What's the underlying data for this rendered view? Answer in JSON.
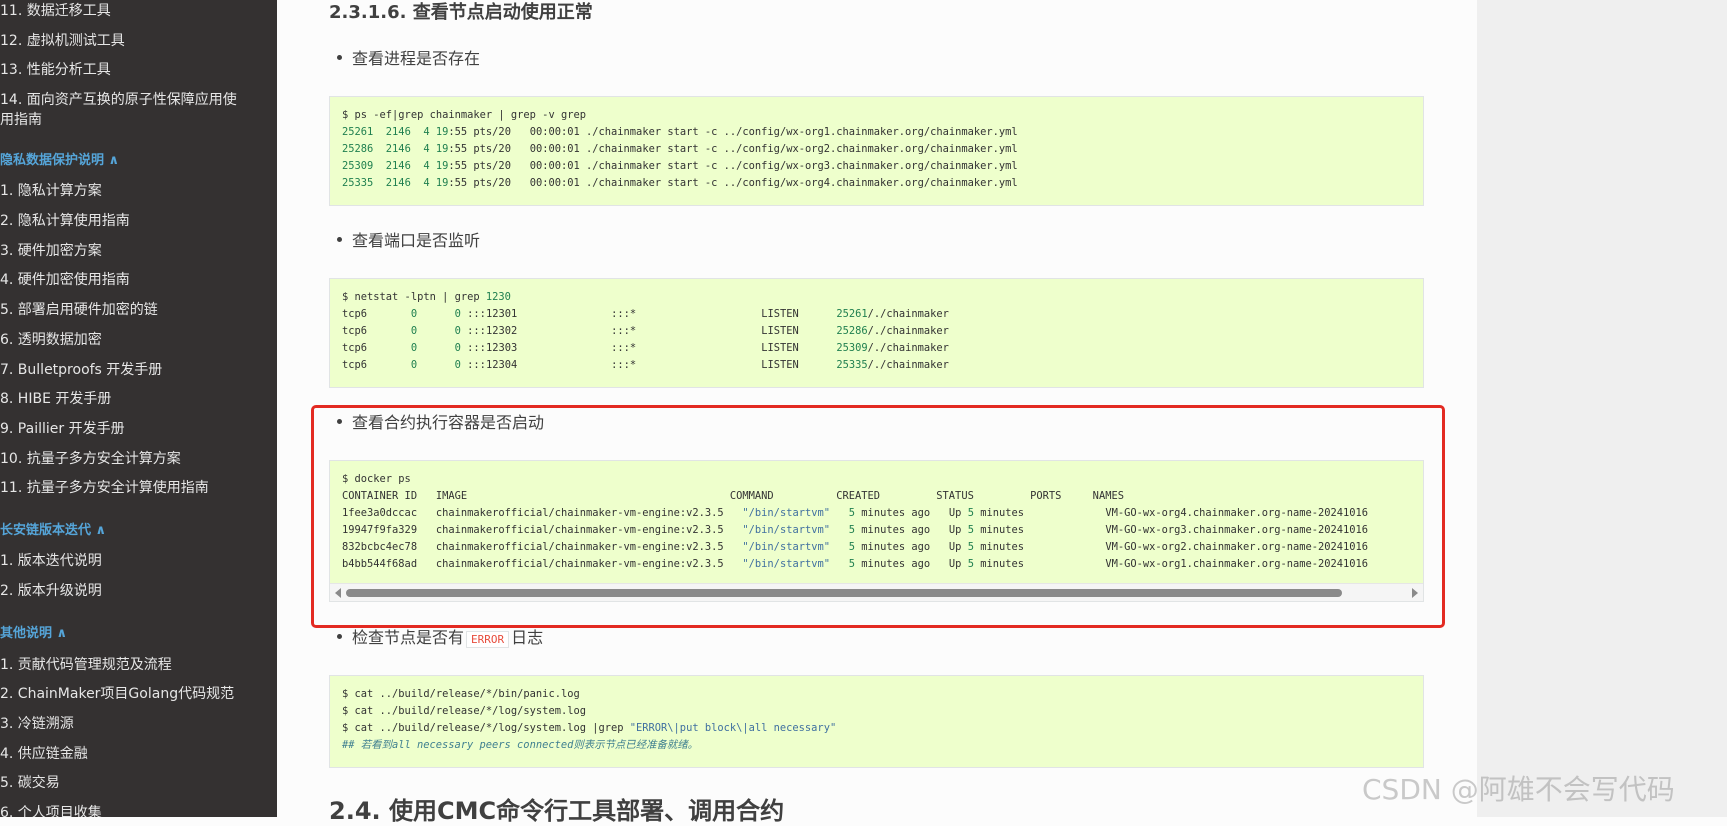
{
  "sidebar": {
    "group1": [
      "11. 数据迁移工具",
      "12. 虚拟机测试工具",
      "13. 性能分析工具",
      "14. 面向资产互换的原子性保障应用使用指南"
    ],
    "caption_privacy": "隐私数据保护说明 ∧",
    "group2": [
      "1. 隐私计算方案",
      "2. 隐私计算使用指南",
      "3. 硬件加密方案",
      "4. 硬件加密使用指南",
      "5. 部署启用硬件加密的链",
      "6. 透明数据加密",
      "7. Bulletproofs 开发手册",
      "8. HIBE 开发手册",
      "9. Paillier 开发手册",
      "10. 抗量子多方安全计算方案",
      "11. 抗量子多方安全计算使用指南"
    ],
    "caption_version": "长安链版本迭代 ∧",
    "group3": [
      "1. 版本迭代说明",
      "2. 版本升级说明"
    ],
    "caption_other": "其他说明 ∧",
    "group4": [
      "1. 贡献代码管理规范及流程",
      "2. ChainMaker项目Golang代码规范",
      "3. 冷链溯源",
      "4. 供应链金融",
      "5. 碳交易",
      "6. 个人项目收集"
    ]
  },
  "main": {
    "section_title": "2.3.1.6. 查看节点启动使用正常",
    "bullet_process": "查看进程是否存在",
    "bullet_port": "查看端口是否监听",
    "bullet_docker": "查看合约执行容器是否启动",
    "bullet_error_pre": "检查节点是否有",
    "bullet_error_code": "ERROR",
    "bullet_error_post": "日志",
    "next_title": "2.4. 使用CMC命令行工具部署、调用合约"
  },
  "code_ps": {
    "cmd": "$ ps -ef|grep chainmaker | grep -v grep",
    "rows": [
      {
        "pid": "25261",
        "ppid": "2146",
        "c": "4",
        "h": "19",
        "rest": ":55 pts/20   00:00:01 ./chainmaker start -c ../config/wx-org1.chainmaker.org/chainmaker.yml"
      },
      {
        "pid": "25286",
        "ppid": "2146",
        "c": "4",
        "h": "19",
        "rest": ":55 pts/20   00:00:01 ./chainmaker start -c ../config/wx-org2.chainmaker.org/chainmaker.yml"
      },
      {
        "pid": "25309",
        "ppid": "2146",
        "c": "4",
        "h": "19",
        "rest": ":55 pts/20   00:00:01 ./chainmaker start -c ../config/wx-org3.chainmaker.org/chainmaker.yml"
      },
      {
        "pid": "25335",
        "ppid": "2146",
        "c": "4",
        "h": "19",
        "rest": ":55 pts/20   00:00:01 ./chainmaker start -c ../config/wx-org4.chainmaker.org/chainmaker.yml"
      }
    ]
  },
  "code_netstat": {
    "cmd": "$ netstat -lptn | grep ",
    "cmd_num": "1230",
    "rows": [
      {
        "proto": "tcp6",
        "a": "0",
        "b": "0",
        "local": ":::12301",
        "foreign": ":::*",
        "state": "LISTEN",
        "pid": "25261",
        "prog": "/./chainmaker"
      },
      {
        "proto": "tcp6",
        "a": "0",
        "b": "0",
        "local": ":::12302",
        "foreign": ":::*",
        "state": "LISTEN",
        "pid": "25286",
        "prog": "/./chainmaker"
      },
      {
        "proto": "tcp6",
        "a": "0",
        "b": "0",
        "local": ":::12303",
        "foreign": ":::*",
        "state": "LISTEN",
        "pid": "25309",
        "prog": "/./chainmaker"
      },
      {
        "proto": "tcp6",
        "a": "0",
        "b": "0",
        "local": ":::12304",
        "foreign": ":::*",
        "state": "LISTEN",
        "pid": "25335",
        "prog": "/./chainmaker"
      }
    ]
  },
  "code_docker": {
    "cmd": "$ docker ps",
    "header": "CONTAINER ID   IMAGE                                          COMMAND          CREATED         STATUS         PORTS     NAMES",
    "rows": [
      {
        "id": "1fee3a0dccac",
        "image": "chainmakerofficial/chainmaker-vm-engine:v2.3.5",
        "command": "\"/bin/startvm\"",
        "created_n": "5",
        "created_t": " minutes ago",
        "status_p": "Up ",
        "status_n": "5",
        "status_t": " minutes",
        "name": "VM-GO-wx-org4.chainmaker.org-name-20241016"
      },
      {
        "id": "19947f9fa329",
        "image": "chainmakerofficial/chainmaker-vm-engine:v2.3.5",
        "command": "\"/bin/startvm\"",
        "created_n": "5",
        "created_t": " minutes ago",
        "status_p": "Up ",
        "status_n": "5",
        "status_t": " minutes",
        "name": "VM-GO-wx-org3.chainmaker.org-name-20241016"
      },
      {
        "id": "832bcbc4ec78",
        "image": "chainmakerofficial/chainmaker-vm-engine:v2.3.5",
        "command": "\"/bin/startvm\"",
        "created_n": "5",
        "created_t": " minutes ago",
        "status_p": "Up ",
        "status_n": "5",
        "status_t": " minutes",
        "name": "VM-GO-wx-org2.chainmaker.org-name-20241016"
      },
      {
        "id": "b4bb544f68ad",
        "image": "chainmakerofficial/chainmaker-vm-engine:v2.3.5",
        "command": "\"/bin/startvm\"",
        "created_n": "5",
        "created_t": " minutes ago",
        "status_p": "Up ",
        "status_n": "5",
        "status_t": " minutes",
        "name": "VM-GO-wx-org1.chainmaker.org-name-20241016"
      }
    ]
  },
  "code_log": {
    "line1": "$ cat ../build/release/*/bin/panic.log",
    "line2": "$ cat ../build/release/*/log/system.log",
    "line3_pre": "$ cat ../build/release/*/log/system.log |grep ",
    "line3_str": "\"ERROR\\|put block\\|all necessary\"",
    "line4": "## 若看到all necessary peers connected则表示节点已经准备就绪。"
  },
  "watermark": "CSDN @阿雄不会写代码"
}
